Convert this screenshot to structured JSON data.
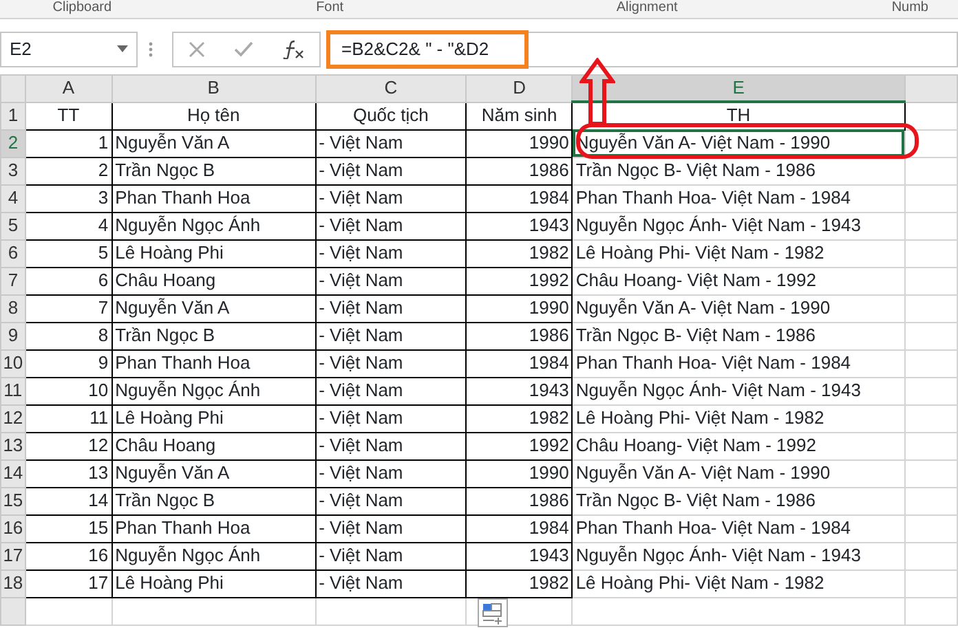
{
  "ribbon_groups": [
    "Clipboard",
    "Font",
    "Alignment",
    "Numb"
  ],
  "name_box": "E2",
  "formula": "=B2&C2& \" - \"&D2",
  "columns": [
    {
      "label": "A",
      "selected": false
    },
    {
      "label": "B",
      "selected": false
    },
    {
      "label": "C",
      "selected": false
    },
    {
      "label": "D",
      "selected": false
    },
    {
      "label": "E",
      "selected": true
    }
  ],
  "header": {
    "row_number": "1",
    "cells": [
      "TT",
      "Họ tên",
      "Quốc tịch",
      "Năm sinh",
      "TH"
    ]
  },
  "rows": [
    {
      "row_number": "2",
      "tt": "1",
      "ho_ten": "Nguyễn Văn A",
      "quoc_tich": "- Việt Nam",
      "nam_sinh": "1990",
      "th": "Nguyễn Văn A- Việt Nam - 1990",
      "selected": true
    },
    {
      "row_number": "3",
      "tt": "2",
      "ho_ten": "Trần Ngọc B",
      "quoc_tich": "- Việt Nam",
      "nam_sinh": "1986",
      "th": "Trần Ngọc B- Việt Nam - 1986",
      "selected": false
    },
    {
      "row_number": "4",
      "tt": "3",
      "ho_ten": "Phan Thanh Hoa",
      "quoc_tich": "- Việt Nam",
      "nam_sinh": "1984",
      "th": "Phan Thanh Hoa- Việt Nam - 1984",
      "selected": false
    },
    {
      "row_number": "5",
      "tt": "4",
      "ho_ten": "Nguyễn Ngọc Ánh",
      "quoc_tich": "- Việt Nam",
      "nam_sinh": "1943",
      "th": "Nguyễn Ngọc Ánh- Việt Nam - 1943",
      "selected": false
    },
    {
      "row_number": "6",
      "tt": "5",
      "ho_ten": "Lê Hoàng Phi",
      "quoc_tich": "- Việt Nam",
      "nam_sinh": "1982",
      "th": "Lê Hoàng Phi- Việt Nam - 1982",
      "selected": false
    },
    {
      "row_number": "7",
      "tt": "6",
      "ho_ten": "Châu Hoang",
      "quoc_tich": "- Việt Nam",
      "nam_sinh": "1992",
      "th": "Châu Hoang- Việt Nam - 1992",
      "selected": false
    },
    {
      "row_number": "8",
      "tt": "7",
      "ho_ten": "Nguyễn Văn A",
      "quoc_tich": "- Việt Nam",
      "nam_sinh": "1990",
      "th": "Nguyễn Văn A- Việt Nam - 1990",
      "selected": false
    },
    {
      "row_number": "9",
      "tt": "8",
      "ho_ten": "Trần Ngọc B",
      "quoc_tich": "- Việt Nam",
      "nam_sinh": "1986",
      "th": "Trần Ngọc B- Việt Nam - 1986",
      "selected": false
    },
    {
      "row_number": "10",
      "tt": "9",
      "ho_ten": "Phan Thanh Hoa",
      "quoc_tich": "- Việt Nam",
      "nam_sinh": "1984",
      "th": "Phan Thanh Hoa- Việt Nam - 1984",
      "selected": false
    },
    {
      "row_number": "11",
      "tt": "10",
      "ho_ten": "Nguyễn Ngọc Ánh",
      "quoc_tich": "- Việt Nam",
      "nam_sinh": "1943",
      "th": "Nguyễn Ngọc Ánh- Việt Nam - 1943",
      "selected": false
    },
    {
      "row_number": "12",
      "tt": "11",
      "ho_ten": "Lê Hoàng Phi",
      "quoc_tich": "- Việt Nam",
      "nam_sinh": "1982",
      "th": "Lê Hoàng Phi- Việt Nam - 1982",
      "selected": false
    },
    {
      "row_number": "13",
      "tt": "12",
      "ho_ten": "Châu Hoang",
      "quoc_tich": "- Việt Nam",
      "nam_sinh": "1992",
      "th": "Châu Hoang- Việt Nam - 1992",
      "selected": false
    },
    {
      "row_number": "14",
      "tt": "13",
      "ho_ten": "Nguyễn Văn A",
      "quoc_tich": "- Việt Nam",
      "nam_sinh": "1990",
      "th": "Nguyễn Văn A- Việt Nam - 1990",
      "selected": false
    },
    {
      "row_number": "15",
      "tt": "14",
      "ho_ten": "Trần Ngọc B",
      "quoc_tich": "- Việt Nam",
      "nam_sinh": "1986",
      "th": "Trần Ngọc B- Việt Nam - 1986",
      "selected": false
    },
    {
      "row_number": "16",
      "tt": "15",
      "ho_ten": "Phan Thanh Hoa",
      "quoc_tich": "- Việt Nam",
      "nam_sinh": "1984",
      "th": "Phan Thanh Hoa- Việt Nam - 1984",
      "selected": false
    },
    {
      "row_number": "17",
      "tt": "16",
      "ho_ten": "Nguyễn Ngọc Ánh",
      "quoc_tich": "- Việt Nam",
      "nam_sinh": "1943",
      "th": "Nguyễn Ngọc Ánh- Việt Nam - 1943",
      "selected": false
    },
    {
      "row_number": "18",
      "tt": "17",
      "ho_ten": "Lê Hoàng Phi",
      "quoc_tich": "- Việt Nam",
      "nam_sinh": "1982",
      "th": "Lê Hoàng Phi- Việt Nam - 1982",
      "selected": false
    }
  ]
}
